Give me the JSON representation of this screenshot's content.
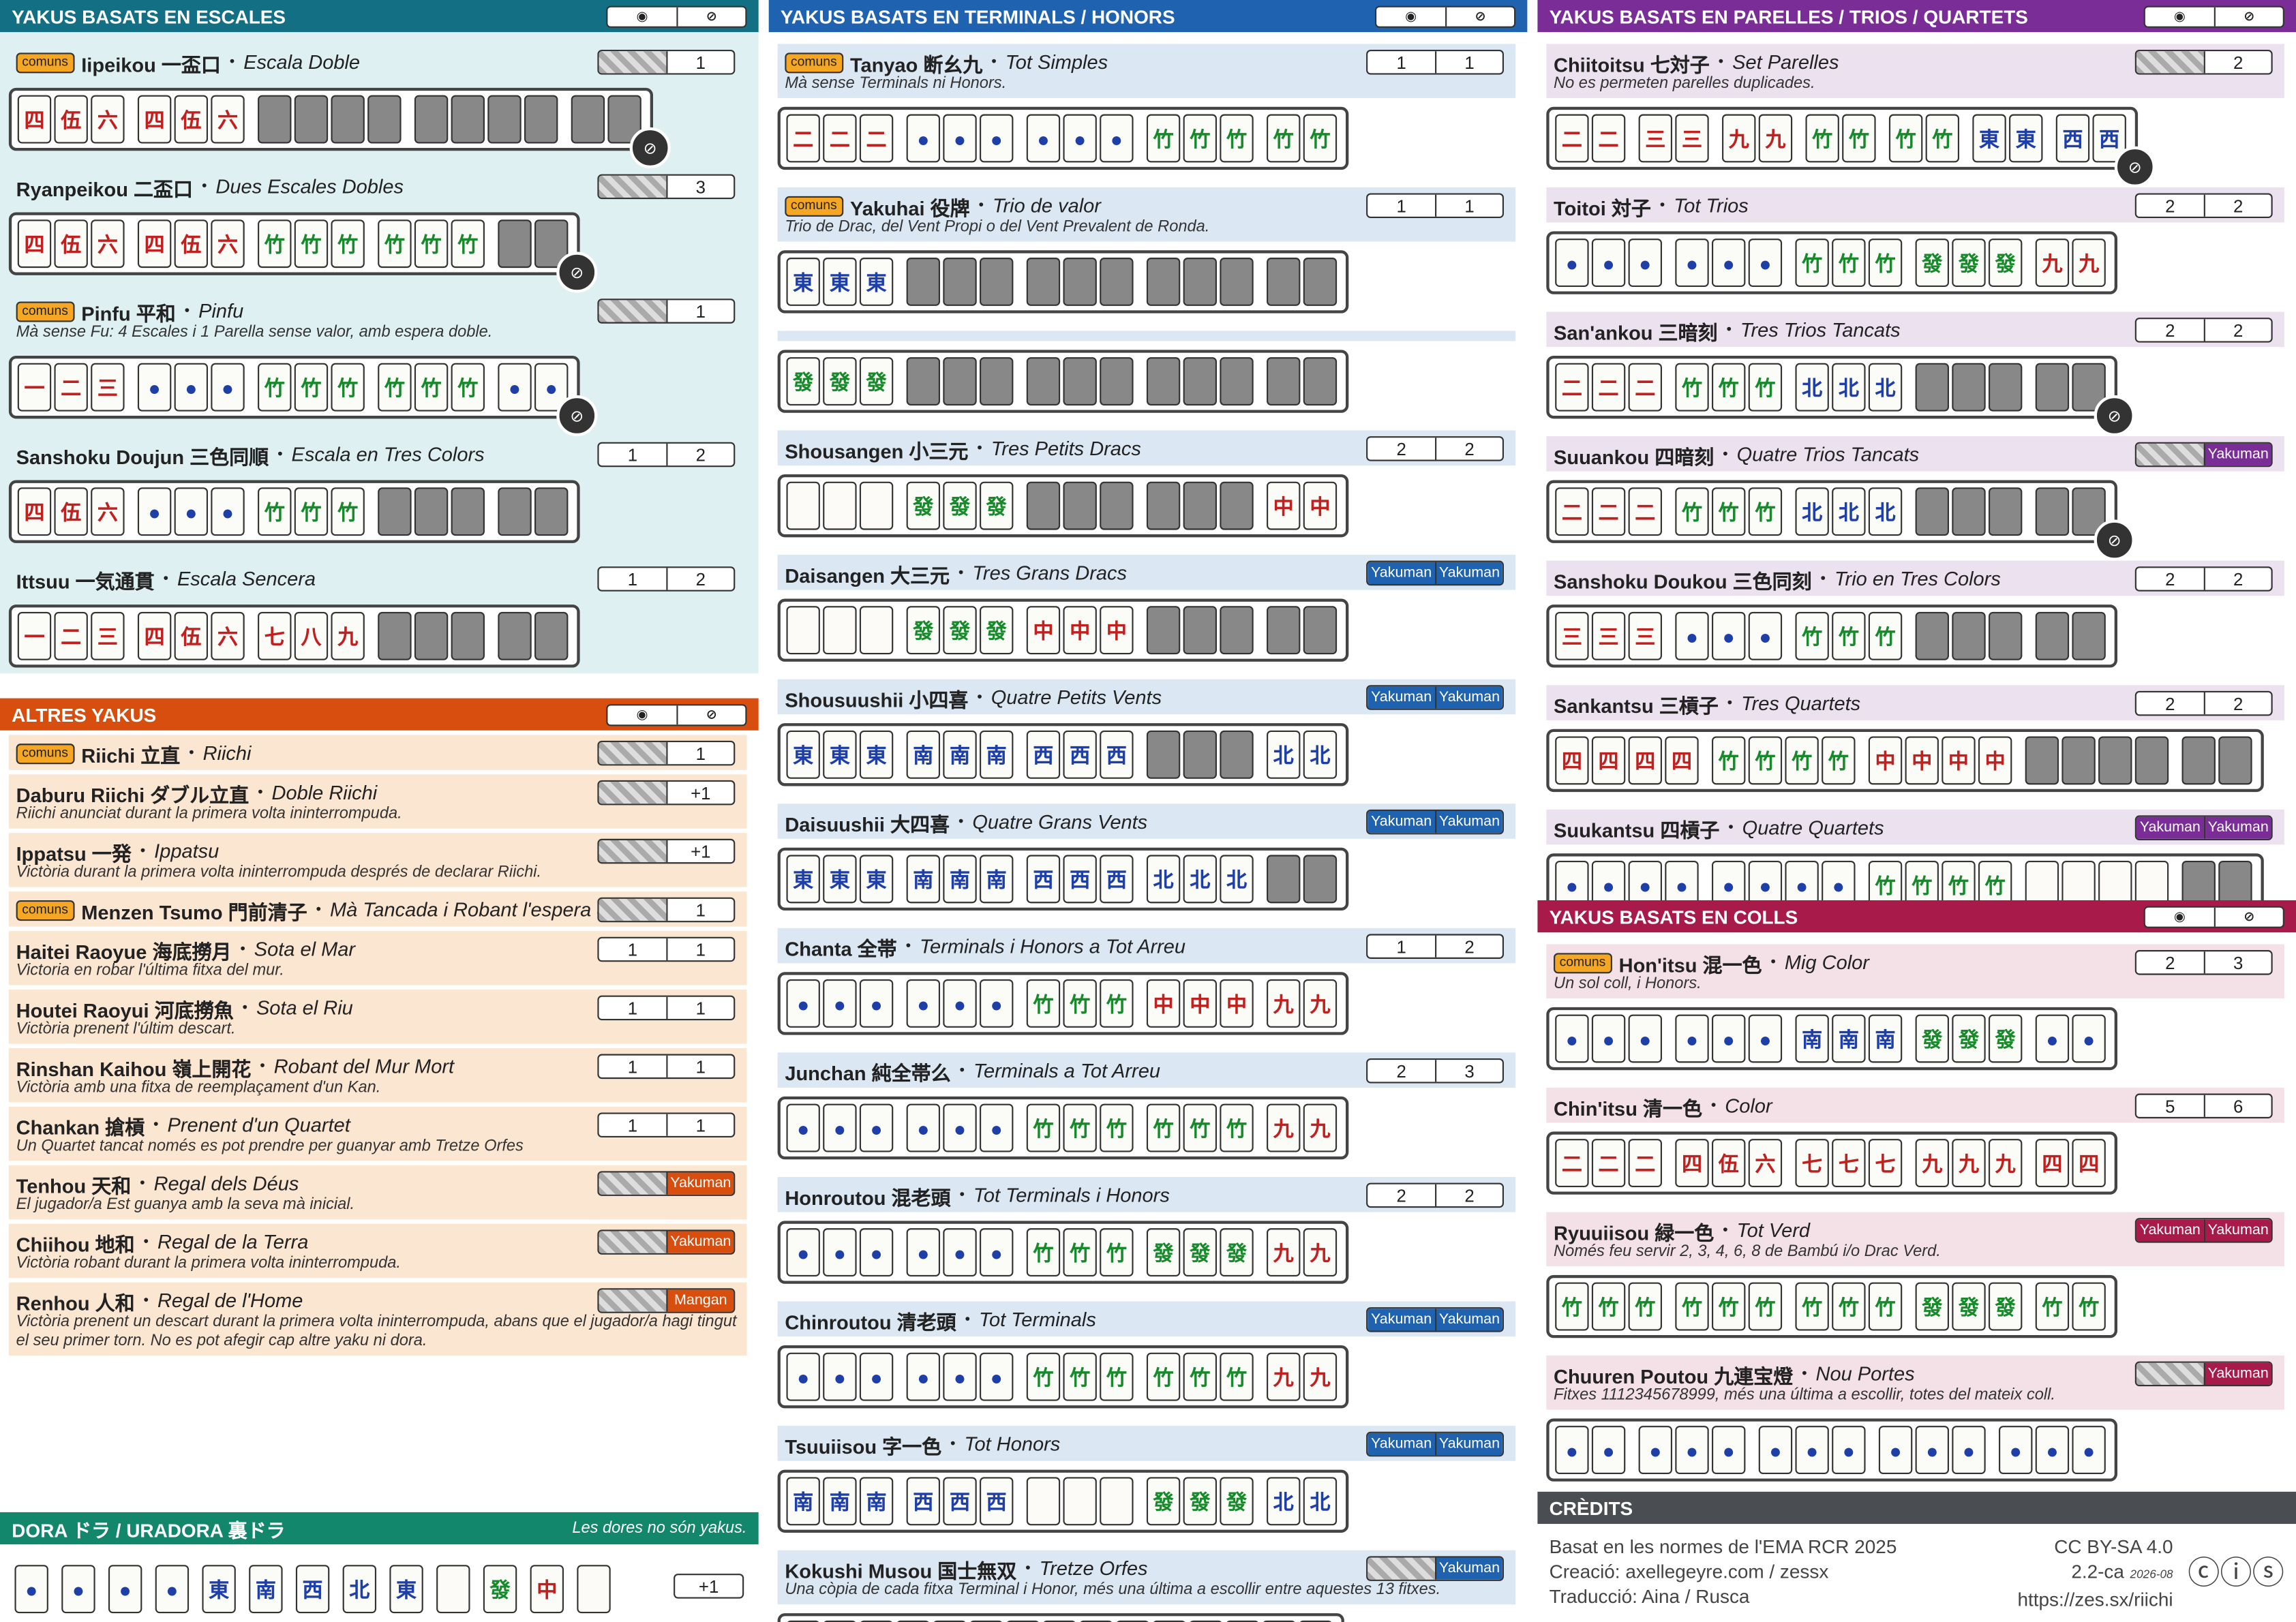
{
  "colors": {
    "escales": "#136f83",
    "escales_bg": "#dff0f2",
    "terminals": "#1f62b0",
    "terminals_bg": "#dbe7f3",
    "parelles": "#7a2d96",
    "parelles_bg": "#ece1ef",
    "altres": "#d74e0e",
    "altres_bg": "#fbe6d2",
    "colls": "#a81a4a",
    "colls_bg": "#f4e1e8",
    "dora": "#12876b",
    "credits": "#4a4d52"
  },
  "icons": {
    "eye": "eye-icon",
    "eye_off": "eye-off-icon"
  },
  "sections": {
    "escales": {
      "title": "YAKUS BASATS EN ESCALES",
      "entries": [
        {
          "badge": "comuns",
          "name": "Iipeikou 一盃口",
          "trans": "Escala Doble",
          "desc": "",
          "h1": "",
          "h2": "1",
          "tiles": "四伍六|四伍六|####|####|##"
        },
        {
          "badge": "",
          "name": "Ryanpeikou 二盃口",
          "trans": "Dues Escales Dobles",
          "desc": "",
          "h1": "",
          "h2": "3",
          "tiles": "四伍六|四伍六|竹竹竹|竹竹竹|##"
        },
        {
          "badge": "comuns",
          "name": "Pinfu 平和",
          "trans": "Pinfu",
          "desc": "Mà sense Fu: 4 Escales i 1 Parella sense valor, amb espera doble.",
          "h1": "",
          "h2": "1",
          "tiles": "一二三|●●●|竹竹竹|竹竹竹|●●"
        },
        {
          "badge": "",
          "name": "Sanshoku Doujun 三色同順",
          "trans": "Escala en Tres Colors",
          "desc": "",
          "h1": "1",
          "h2": "2",
          "tiles": "四伍六|●●●|竹竹竹|###|##"
        },
        {
          "badge": "",
          "name": "Ittsuu 一気通貫",
          "trans": "Escala Sencera",
          "desc": "",
          "h1": "1",
          "h2": "2",
          "tiles": "一二三|四伍六|七八九|###|##"
        }
      ]
    },
    "altres": {
      "title": "ALTRES YAKUS",
      "entries": [
        {
          "badge": "comuns",
          "name": "Riichi 立直",
          "trans": "Riichi",
          "desc": "",
          "h1": "",
          "h2": "1"
        },
        {
          "badge": "",
          "name": "Daburu Riichi ダブル立直",
          "trans": "Doble Riichi",
          "desc": "Riichi anunciat durant la primera volta ininterrompuda.",
          "h1": "",
          "h2": "+1"
        },
        {
          "badge": "",
          "name": "Ippatsu 一発",
          "trans": "Ippatsu",
          "desc": "Victòria durant la primera volta ininterrompuda després de declarar Riichi.",
          "h1": "",
          "h2": "+1"
        },
        {
          "badge": "comuns",
          "name": "Menzen Tsumo 門前清子",
          "trans": "Mà Tancada i Robant l'espera del mur",
          "desc": "",
          "h1": "",
          "h2": "1"
        },
        {
          "badge": "",
          "name": "Haitei Raoyue 海底撈月",
          "trans": "Sota el Mar",
          "desc": "Victoria en robar l'última fitxa del mur.",
          "h1": "1",
          "h2": "1"
        },
        {
          "badge": "",
          "name": "Houtei Raoyui 河底撈魚",
          "trans": "Sota el Riu",
          "desc": "Victòria prenent l'últim descart.",
          "h1": "1",
          "h2": "1"
        },
        {
          "badge": "",
          "name": "Rinshan Kaihou 嶺上開花",
          "trans": "Robant del Mur Mort",
          "desc": "Victòria amb una fitxa de reemplaçament d'un Kan.",
          "h1": "1",
          "h2": "1"
        },
        {
          "badge": "",
          "name": "Chankan 搶槓",
          "trans": "Prenent d'un Quartet",
          "desc": "Un Quartet tancat només es pot prendre per guanyar amb Tretze Orfes",
          "h1": "1",
          "h2": "1"
        },
        {
          "badge": "",
          "name": "Tenhou 天和",
          "trans": "Regal dels Déus",
          "desc": "El jugador/a Est guanya amb la seva mà inicial.",
          "h1": "",
          "h2": "Yakuman"
        },
        {
          "badge": "",
          "name": "Chiihou 地和",
          "trans": "Regal de la Terra",
          "desc": "Victòria robant durant la primera volta ininterrompuda.",
          "h1": "",
          "h2": "Yakuman"
        },
        {
          "badge": "",
          "name": "Renhou 人和",
          "trans": "Regal de l'Home",
          "desc": "Victòria prenent un descart durant la primera volta ininterrompuda, abans que el jugador/a hagi tingut el seu primer torn. No es pot afegir cap altre yaku ni dora.",
          "h1": "",
          "h2": "Mangan"
        }
      ]
    },
    "dora": {
      "title": "DORA ドラ / URADORA 裏ドラ",
      "note": "Les dores no són yakus.",
      "h2": "+1"
    },
    "terminals": {
      "title": "YAKUS BASATS EN TERMINALS / HONORS",
      "entries": [
        {
          "badge": "comuns",
          "name": "Tanyao 断幺九",
          "trans": "Tot Simples",
          "desc": "Mà sense Terminals ni Honors.",
          "h1": "1",
          "h2": "1",
          "tiles": "二二二|●●●|●●●|竹竹竹|竹竹"
        },
        {
          "badge": "comuns",
          "name": "Yakuhai 役牌",
          "trans": "Trio de valor",
          "desc": "Trio de Drac, del Vent Propi o del Vent Prevalent de Ronda.",
          "h1": "1",
          "h2": "1",
          "tiles": "東東東|###|###|###|##"
        },
        {
          "badge": "",
          "name": "",
          "trans": "",
          "desc": "",
          "h1": "",
          "h2": "",
          "tiles": "發發發|###|###|###|##"
        },
        {
          "badge": "",
          "name": "Shousangen 小三元",
          "trans": "Tres Petits Dracs",
          "desc": "",
          "h1": "2",
          "h2": "2",
          "tiles": "___|發發發|###|###|中中"
        },
        {
          "badge": "",
          "name": "Daisangen 大三元",
          "trans": "Tres Grans Dracs",
          "desc": "",
          "h1": "Yakuman",
          "h2": "Yakuman",
          "tiles": "___|發發發|中中中|###|##"
        },
        {
          "badge": "",
          "name": "Shousuushii 小四喜",
          "trans": "Quatre Petits Vents",
          "desc": "",
          "h1": "Yakuman",
          "h2": "Yakuman",
          "tiles": "東東東|南南南|西西西|###|北北"
        },
        {
          "badge": "",
          "name": "Daisuushii 大四喜",
          "trans": "Quatre Grans Vents",
          "desc": "",
          "h1": "Yakuman",
          "h2": "Yakuman",
          "tiles": "東東東|南南南|西西西|北北北|##"
        },
        {
          "badge": "",
          "name": "Chanta 全帯",
          "trans": "Terminals i Honors a Tot Arreu",
          "desc": "",
          "h1": "1",
          "h2": "2",
          "tiles": "●●●|●●●|竹竹竹|中中中|九九"
        },
        {
          "badge": "",
          "name": "Junchan 純全帯么",
          "trans": "Terminals a Tot Arreu",
          "desc": "",
          "h1": "2",
          "h2": "3",
          "tiles": "●●●|●●●|竹竹竹|竹竹竹|九九"
        },
        {
          "badge": "",
          "name": "Honroutou 混老頭",
          "trans": "Tot Terminals i Honors",
          "desc": "",
          "h1": "2",
          "h2": "2",
          "tiles": "●●●|●●●|竹竹竹|發發發|九九"
        },
        {
          "badge": "",
          "name": "Chinroutou 清老頭",
          "trans": "Tot Terminals",
          "desc": "",
          "h1": "Yakuman",
          "h2": "Yakuman",
          "tiles": "●●●|●●●|竹竹竹|竹竹竹|九九"
        },
        {
          "badge": "",
          "name": "Tsuuiisou 字一色",
          "trans": "Tot Honors",
          "desc": "",
          "h1": "Yakuman",
          "h2": "Yakuman",
          "tiles": "南南南|西西西|___|發發發|北北"
        },
        {
          "badge": "",
          "name": "Kokushi Musou 国士無双",
          "trans": "Tretze Orfes",
          "desc": "Una còpia de cada fitxa Terminal i Honor, més una última a escollir entre aquestes 13 fitxes.",
          "h1": "",
          "h2": "Yakuman",
          "tiles": "一九●●●●竹東南西北中_發九"
        }
      ]
    },
    "parelles": {
      "title": "YAKUS BASATS EN PARELLES / TRIOS / QUARTETS",
      "entries": [
        {
          "badge": "",
          "name": "Chiitoitsu 七対子",
          "trans": "Set Parelles",
          "desc": "No es permeten parelles duplicades.",
          "h1": "",
          "h2": "2",
          "tiles": "二二|三三|九九|竹竹|竹竹|東東|西西"
        },
        {
          "badge": "",
          "name": "Toitoi 対子",
          "trans": "Tot Trios",
          "desc": "",
          "h1": "2",
          "h2": "2",
          "tiles": "●●●|●●●|竹竹竹|發發發|九九"
        },
        {
          "badge": "",
          "name": "San'ankou 三暗刻",
          "trans": "Tres Trios Tancats",
          "desc": "",
          "h1": "2",
          "h2": "2",
          "tiles": "二二二|竹竹竹|北北北|###|##"
        },
        {
          "badge": "",
          "name": "Suuankou 四暗刻",
          "trans": "Quatre Trios Tancats",
          "desc": "",
          "h1": "",
          "h2": "Yakuman",
          "tiles": "二二二|竹竹竹|北北北|###|##"
        },
        {
          "badge": "",
          "name": "Sanshoku Doukou 三色同刻",
          "trans": "Trio en Tres Colors",
          "desc": "",
          "h1": "2",
          "h2": "2",
          "tiles": "三三三|●●●|竹竹竹|###|##"
        },
        {
          "badge": "",
          "name": "Sankantsu 三槓子",
          "trans": "Tres Quartets",
          "desc": "",
          "h1": "2",
          "h2": "2",
          "tiles": "四四四四|竹竹竹竹|中中中中|####|##"
        },
        {
          "badge": "",
          "name": "Suukantsu 四槓子",
          "trans": "Quatre Quartets",
          "desc": "",
          "h1": "Yakuman",
          "h2": "Yakuman",
          "tiles": "●●●●|●●●●|竹竹竹竹|____|##"
        }
      ]
    },
    "colls": {
      "title": "YAKUS BASATS EN COLLS",
      "entries": [
        {
          "badge": "comuns",
          "name": "Hon'itsu 混一色",
          "trans": "Mig Color",
          "desc": "Un sol coll, i Honors.",
          "h1": "2",
          "h2": "3",
          "tiles": "●●●|●●●|南南南|發發發|●●"
        },
        {
          "badge": "",
          "name": "Chin'itsu 清一色",
          "trans": "Color",
          "desc": "",
          "h1": "5",
          "h2": "6",
          "tiles": "二二二|四伍六|七七七|九九九|四四"
        },
        {
          "badge": "",
          "name": "Ryuuiisou 緑一色",
          "trans": "Tot Verd",
          "desc": "Només feu servir 2, 3, 4, 6, 8 de Bambú i/o Drac Verd.",
          "h1": "Yakuman",
          "h2": "Yakuman",
          "tiles": "竹竹竹|竹竹竹|竹竹竹|發發發|竹竹"
        },
        {
          "badge": "",
          "name": "Chuuren Poutou 九連宝燈",
          "trans": "Nou Portes",
          "desc": "Fitxes 1112345678999, més una última a escollir, totes del mateix coll.",
          "h1": "",
          "h2": "Yakuman",
          "tiles": "●●|●●●|●●●|●●●|●●●"
        }
      ]
    },
    "credits": {
      "title": "CRÈDITS",
      "l1": "Basat en les normes de l'EMA RCR 2025",
      "l2": "Creació: axellegeyre.com / zessx",
      "l3": "Traducció: Aina / Rusca",
      "r1": "CC BY-SA 4.0",
      "r2": "2.2-ca",
      "r2b": "2026-08",
      "r3": "https://zes.sx/riichi"
    }
  }
}
